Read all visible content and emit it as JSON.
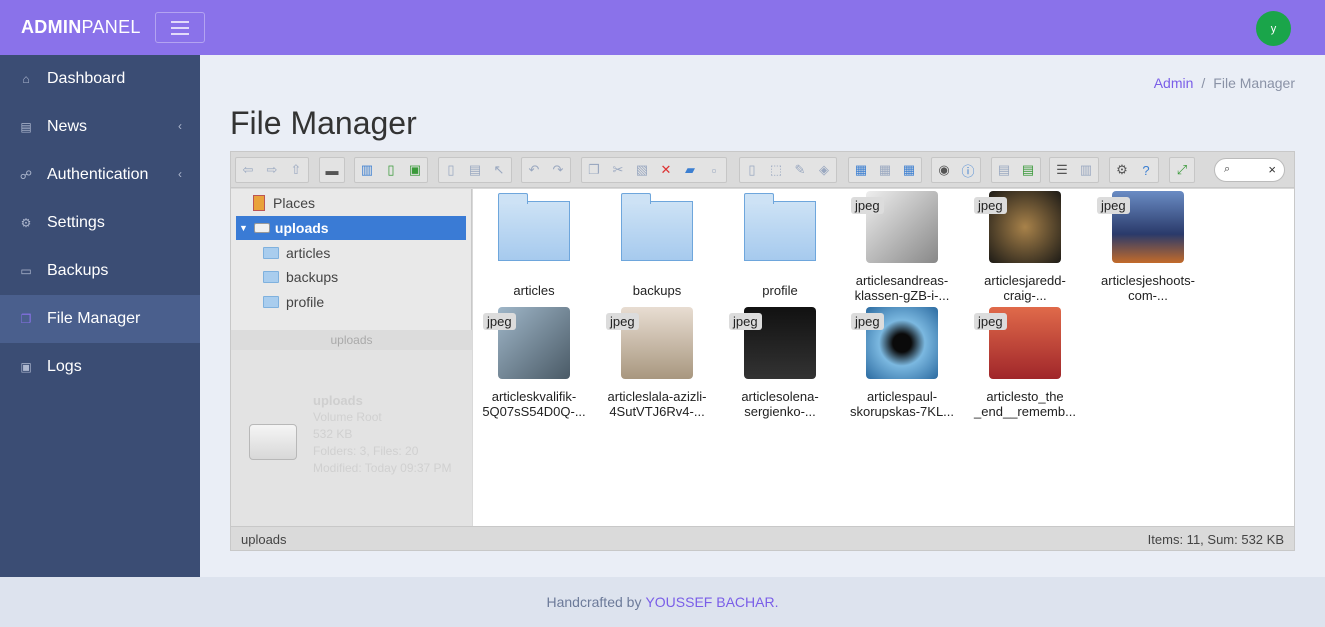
{
  "header": {
    "brand_bold": "ADMIN",
    "brand_light": "PANEL",
    "avatar_initial": "y",
    "colors": {
      "topbar": "#8a72ea",
      "avatar": "#1aa54a"
    }
  },
  "sidebar": {
    "items": [
      {
        "label": "Dashboard",
        "icon": "home-icon",
        "has_chevron": false,
        "active": false
      },
      {
        "label": "News",
        "icon": "newspaper-icon",
        "has_chevron": true,
        "active": false
      },
      {
        "label": "Authentication",
        "icon": "users-icon",
        "has_chevron": true,
        "active": false
      },
      {
        "label": "Settings",
        "icon": "gear-icon",
        "has_chevron": false,
        "active": false
      },
      {
        "label": "Backups",
        "icon": "hard-drive-icon",
        "has_chevron": false,
        "active": false
      },
      {
        "label": "File Manager",
        "icon": "copy-icon",
        "has_chevron": false,
        "active": true
      },
      {
        "label": "Logs",
        "icon": "terminal-icon",
        "has_chevron": false,
        "active": false
      }
    ]
  },
  "breadcrumb": {
    "root": "Admin",
    "separator": "/",
    "current": "File Manager"
  },
  "page": {
    "title": "File Manager"
  },
  "file_manager": {
    "search_placeholder": "",
    "tree": {
      "places": "Places",
      "root": "uploads",
      "children": [
        "articles",
        "backups",
        "profile"
      ],
      "panel_title": "uploads",
      "volume": {
        "name": "uploads",
        "type": "Volume Root",
        "size": "532 KB",
        "counts": "Folders: 3, Files: 20",
        "modified": "Modified: Today 09:37 PM"
      }
    },
    "files": [
      {
        "name": "articles",
        "kind": "folder"
      },
      {
        "name": "backups",
        "kind": "folder"
      },
      {
        "name": "profile",
        "kind": "folder"
      },
      {
        "name": "articlesandreas-klassen-gZB-i-...",
        "kind": "image",
        "badge": "jpeg",
        "tint": "#c9c9c9"
      },
      {
        "name": "articlesjaredd-craig-...",
        "kind": "image",
        "badge": "jpeg",
        "tint": "#3a3024"
      },
      {
        "name": "articlesjeshoots-com-...",
        "kind": "image",
        "badge": "jpeg",
        "tint": "#3f5e8f"
      },
      {
        "name": "articleskvalifik-5Q07sS54D0Q-...",
        "kind": "image",
        "badge": "jpeg",
        "tint": "#6f8aa0"
      },
      {
        "name": "articleslala-azizli-4SutVTJ6Rv4-...",
        "kind": "image",
        "badge": "jpeg",
        "tint": "#cfc4b8"
      },
      {
        "name": "articlesolena-sergienko-...",
        "kind": "image",
        "badge": "jpeg",
        "tint": "#1c1c1c"
      },
      {
        "name": "articlespaul-skorupskas-7KL...",
        "kind": "image",
        "badge": "jpeg",
        "tint": "#2e6fa3"
      },
      {
        "name": "articlesto_the _end__rememb...",
        "kind": "image",
        "badge": "jpeg",
        "tint": "#c0443c"
      }
    ],
    "status_left": "uploads",
    "status_right": "Items: 11, Sum: 532 KB"
  },
  "footer": {
    "text": "Handcrafted by",
    "author": "YOUSSEF BACHAR."
  }
}
